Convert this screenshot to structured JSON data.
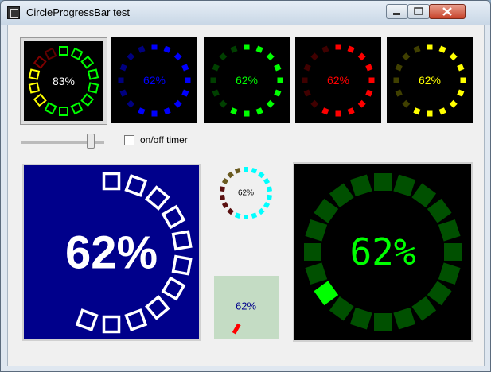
{
  "window": {
    "title": "CircleProgressBar test",
    "minimize_icon": "minimize-icon",
    "maximize_icon": "maximize-icon",
    "close_icon": "close-icon"
  },
  "small_bars": [
    {
      "label": "83%",
      "bg": "#000000",
      "text_color": "#ffffff",
      "shape": "outline-square",
      "colors": [
        "#ff0000",
        "#ffff00",
        "#00ff00"
      ],
      "progress_percent": 83
    },
    {
      "label": "62%",
      "bg": "#000000",
      "text_color": "#0000ff",
      "shape": "filled-square",
      "colors": [
        "#000080",
        "#0000ff"
      ],
      "progress_percent": 62
    },
    {
      "label": "62%",
      "bg": "#000000",
      "text_color": "#00ff00",
      "shape": "filled-square",
      "colors": [
        "#004000",
        "#00ff00"
      ],
      "progress_percent": 62
    },
    {
      "label": "62%",
      "bg": "#000000",
      "text_color": "#ff0000",
      "shape": "filled-square",
      "colors": [
        "#400000",
        "#ff0000"
      ],
      "progress_percent": 62
    },
    {
      "label": "62%",
      "bg": "#000000",
      "text_color": "#ffff00",
      "shape": "filled-square",
      "colors": [
        "#404000",
        "#ffff00"
      ],
      "progress_percent": 62
    }
  ],
  "controls": {
    "slider_level_percent": 83,
    "checkbox_label": "on/off timer",
    "checkbox_checked": false
  },
  "large_blue": {
    "label": "62%",
    "bg": "#00008b",
    "color": "#ffffff",
    "progress_percent": 62
  },
  "mini_circle": {
    "label": "62%",
    "colors": [
      "#ffffff",
      "#00ffff",
      "#5a1010",
      "#6a5a20"
    ]
  },
  "mini_box": {
    "label": "62%",
    "bg": "#c4dcc4",
    "text_color": "#00008b",
    "indicator_color": "#ff0000"
  },
  "large_green": {
    "label": "62%",
    "bg": "#000000",
    "color_dim": "#005000",
    "color_active": "#00ff00",
    "progress_percent": 62
  }
}
